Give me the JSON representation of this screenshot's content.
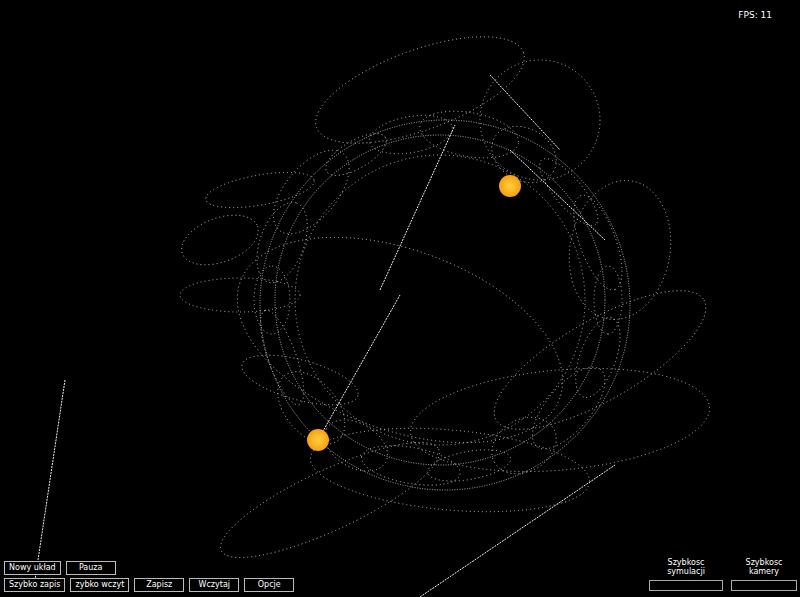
{
  "fps": "FPS: 11",
  "button_rows": [
    [
      {
        "label": "Nowy układ"
      },
      {
        "label": "Pauza"
      }
    ],
    [
      {
        "label": "Szybko zapis"
      },
      {
        "label": "zybko wczyt"
      },
      {
        "label": "Zapisz"
      },
      {
        "label": "Wczytaj"
      },
      {
        "label": "Opcje"
      }
    ]
  ],
  "sliders": [
    {
      "label": "Szybkosc symulacji",
      "level": 0.0
    },
    {
      "label": "Szybkosc kamery",
      "level": 0.0
    }
  ]
}
